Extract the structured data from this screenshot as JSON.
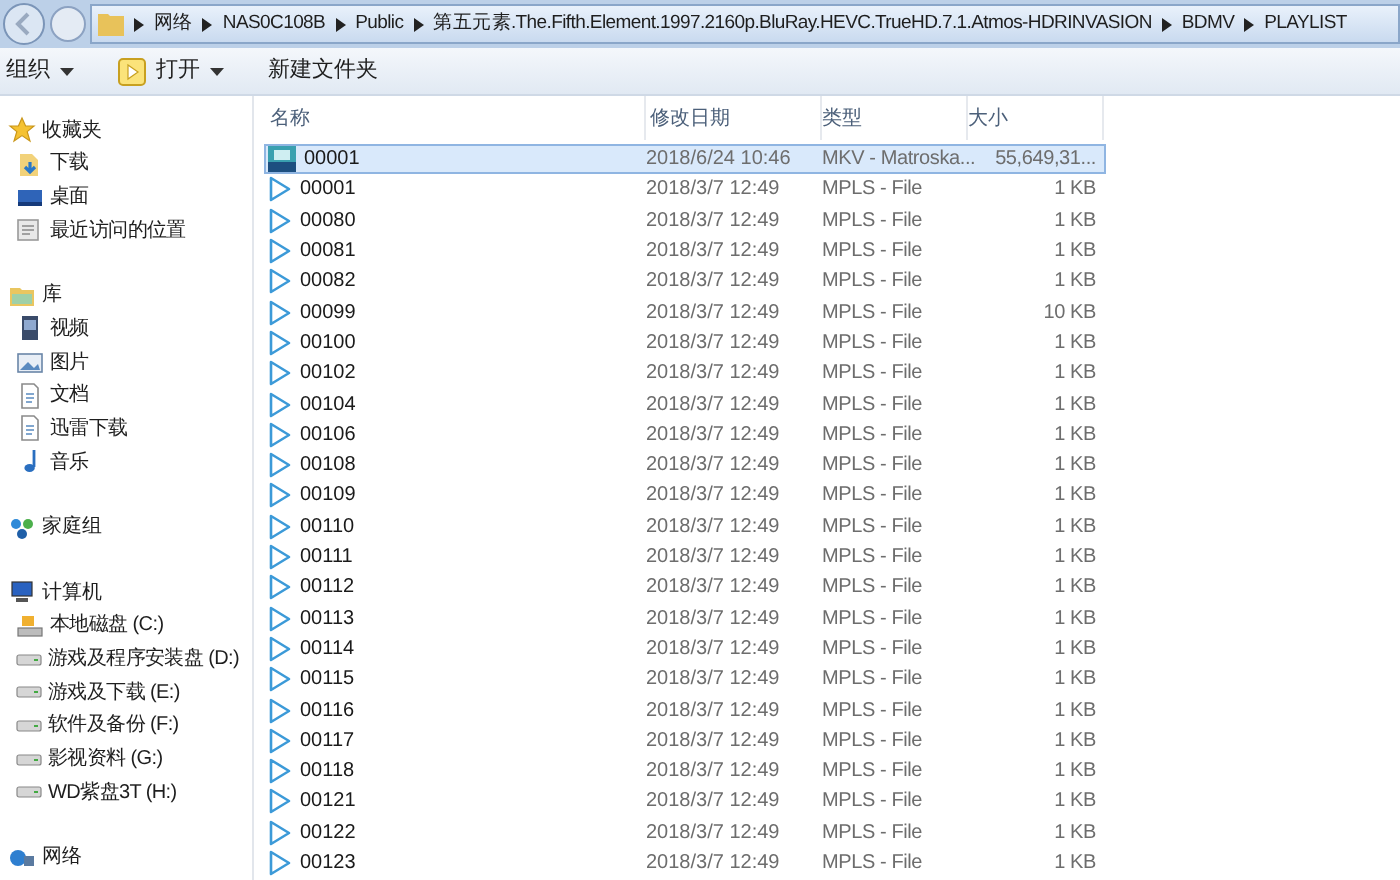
{
  "address_bar": {
    "segments": [
      "网络",
      "NAS0C108B",
      "Public",
      "第五元素.The.Fifth.Element.1997.2160p.BluRay.HEVC.TrueHD.7.1.Atmos-HDRINVASION",
      "BDMV",
      "PLAYLIST"
    ]
  },
  "toolbar": [
    {
      "label": "组织",
      "kind": "menu"
    },
    {
      "label": "打开",
      "kind": "open"
    },
    {
      "label": "新建文件夹",
      "kind": "plain"
    }
  ],
  "sidebar": [
    {
      "label": "收藏夹",
      "kind": "star",
      "children": [
        {
          "label": "下载",
          "kind": "download"
        },
        {
          "label": "桌面",
          "kind": "desktop"
        },
        {
          "label": "最近访问的位置",
          "kind": "recent"
        }
      ]
    },
    {
      "label": "库",
      "kind": "library",
      "children": [
        {
          "label": "视频",
          "kind": "video"
        },
        {
          "label": "图片",
          "kind": "image"
        },
        {
          "label": "文档",
          "kind": "document"
        },
        {
          "label": "迅雷下载",
          "kind": "document"
        },
        {
          "label": "音乐",
          "kind": "music"
        }
      ]
    },
    {
      "label": "家庭组",
      "kind": "homegroup"
    },
    {
      "label": "计算机",
      "kind": "computer",
      "children": [
        {
          "label": "本地磁盘 (C:)",
          "kind": "system-drive"
        },
        {
          "label": "游戏及程序安装盘 (D:)",
          "kind": "drive"
        },
        {
          "label": "游戏及下载 (E:)",
          "kind": "drive"
        },
        {
          "label": "软件及备份 (F:)",
          "kind": "drive"
        },
        {
          "label": "影视资料 (G:)",
          "kind": "drive"
        },
        {
          "label": "WD紫盘3T (H:)",
          "kind": "drive"
        }
      ]
    },
    {
      "label": "网络",
      "kind": "network"
    }
  ],
  "table": {
    "columns": [
      "名称",
      "修改日期",
      "类型",
      "大小"
    ],
    "rows": [
      {
        "kind": "mkv",
        "selected": true,
        "cells": [
          "00001",
          "2018/6/24 10:46",
          "MKV - Matroska...",
          "55,649,31..."
        ]
      },
      {
        "kind": "mpls",
        "selected": false,
        "cells": [
          "00001",
          "2018/3/7 12:49",
          "MPLS - File",
          "1 KB"
        ]
      },
      {
        "kind": "mpls",
        "selected": false,
        "cells": [
          "00080",
          "2018/3/7 12:49",
          "MPLS - File",
          "1 KB"
        ]
      },
      {
        "kind": "mpls",
        "selected": false,
        "cells": [
          "00081",
          "2018/3/7 12:49",
          "MPLS - File",
          "1 KB"
        ]
      },
      {
        "kind": "mpls",
        "selected": false,
        "cells": [
          "00082",
          "2018/3/7 12:49",
          "MPLS - File",
          "1 KB"
        ]
      },
      {
        "kind": "mpls",
        "selected": false,
        "cells": [
          "00099",
          "2018/3/7 12:49",
          "MPLS - File",
          "10 KB"
        ]
      },
      {
        "kind": "mpls",
        "selected": false,
        "cells": [
          "00100",
          "2018/3/7 12:49",
          "MPLS - File",
          "1 KB"
        ]
      },
      {
        "kind": "mpls",
        "selected": false,
        "cells": [
          "00102",
          "2018/3/7 12:49",
          "MPLS - File",
          "1 KB"
        ]
      },
      {
        "kind": "mpls",
        "selected": false,
        "cells": [
          "00104",
          "2018/3/7 12:49",
          "MPLS - File",
          "1 KB"
        ]
      },
      {
        "kind": "mpls",
        "selected": false,
        "cells": [
          "00106",
          "2018/3/7 12:49",
          "MPLS - File",
          "1 KB"
        ]
      },
      {
        "kind": "mpls",
        "selected": false,
        "cells": [
          "00108",
          "2018/3/7 12:49",
          "MPLS - File",
          "1 KB"
        ]
      },
      {
        "kind": "mpls",
        "selected": false,
        "cells": [
          "00109",
          "2018/3/7 12:49",
          "MPLS - File",
          "1 KB"
        ]
      },
      {
        "kind": "mpls",
        "selected": false,
        "cells": [
          "00110",
          "2018/3/7 12:49",
          "MPLS - File",
          "1 KB"
        ]
      },
      {
        "kind": "mpls",
        "selected": false,
        "cells": [
          "00111",
          "2018/3/7 12:49",
          "MPLS - File",
          "1 KB"
        ]
      },
      {
        "kind": "mpls",
        "selected": false,
        "cells": [
          "00112",
          "2018/3/7 12:49",
          "MPLS - File",
          "1 KB"
        ]
      },
      {
        "kind": "mpls",
        "selected": false,
        "cells": [
          "00113",
          "2018/3/7 12:49",
          "MPLS - File",
          "1 KB"
        ]
      },
      {
        "kind": "mpls",
        "selected": false,
        "cells": [
          "00114",
          "2018/3/7 12:49",
          "MPLS - File",
          "1 KB"
        ]
      },
      {
        "kind": "mpls",
        "selected": false,
        "cells": [
          "00115",
          "2018/3/7 12:49",
          "MPLS - File",
          "1 KB"
        ]
      },
      {
        "kind": "mpls",
        "selected": false,
        "cells": [
          "00116",
          "2018/3/7 12:49",
          "MPLS - File",
          "1 KB"
        ]
      },
      {
        "kind": "mpls",
        "selected": false,
        "cells": [
          "00117",
          "2018/3/7 12:49",
          "MPLS - File",
          "1 KB"
        ]
      },
      {
        "kind": "mpls",
        "selected": false,
        "cells": [
          "00118",
          "2018/3/7 12:49",
          "MPLS - File",
          "1 KB"
        ]
      },
      {
        "kind": "mpls",
        "selected": false,
        "cells": [
          "00121",
          "2018/3/7 12:49",
          "MPLS - File",
          "1 KB"
        ]
      },
      {
        "kind": "mpls",
        "selected": false,
        "cells": [
          "00122",
          "2018/3/7 12:49",
          "MPLS - File",
          "1 KB"
        ]
      },
      {
        "kind": "mpls",
        "selected": false,
        "cells": [
          "00123",
          "2018/3/7 12:49",
          "MPLS - File",
          "1 KB"
        ]
      }
    ]
  }
}
